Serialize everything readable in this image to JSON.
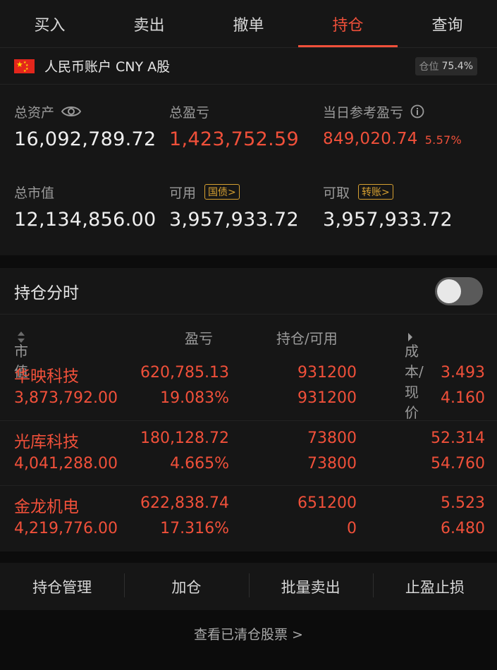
{
  "tabs": [
    {
      "label": "买入"
    },
    {
      "label": "卖出"
    },
    {
      "label": "撤单"
    },
    {
      "label": "持仓"
    },
    {
      "label": "查询"
    }
  ],
  "account": {
    "name": "人民币账户 CNY A股",
    "position_label": "仓位",
    "position_value": "75.4%",
    "total_assets_label": "总资产",
    "total_assets": "16,092,789.72",
    "total_pnl_label": "总盈亏",
    "total_pnl": "1,423,752.59",
    "daily_pnl_label": "当日参考盈亏",
    "daily_pnl": "849,020.74",
    "daily_pnl_pct": "5.57%",
    "market_value_label": "总市值",
    "market_value": "12,134,856.00",
    "available_label": "可用",
    "available_tag": "国债>",
    "available": "3,957,933.72",
    "withdrawable_label": "可取",
    "withdrawable_tag": "转账>",
    "withdrawable": "3,957,933.72"
  },
  "holdings": {
    "title": "持仓分时",
    "headers": {
      "market_value": "市值",
      "pnl": "盈亏",
      "qty": "持仓/可用",
      "price": "成本/现价"
    },
    "rows": [
      {
        "name": "华映科技",
        "market_value": "3,873,792.00",
        "pnl": "620,785.13",
        "pnl_pct": "19.083%",
        "position": "931200",
        "available": "931200",
        "cost": "3.493",
        "price": "4.160"
      },
      {
        "name": "光库科技",
        "market_value": "4,041,288.00",
        "pnl": "180,128.72",
        "pnl_pct": "4.665%",
        "position": "73800",
        "available": "73800",
        "cost": "52.314",
        "price": "54.760"
      },
      {
        "name": "金龙机电",
        "market_value": "4,219,776.00",
        "pnl": "622,838.74",
        "pnl_pct": "17.316%",
        "position": "651200",
        "available": "0",
        "cost": "5.523",
        "price": "6.480"
      }
    ]
  },
  "actions": [
    {
      "label": "持仓管理"
    },
    {
      "label": "加仓"
    },
    {
      "label": "批量卖出"
    },
    {
      "label": "止盈止损"
    }
  ],
  "footer": {
    "cleared_link": "查看已清仓股票 >"
  },
  "colors": {
    "accent_red": "#f0503a",
    "tag_gold": "#d6a031",
    "background": "#0c0c0c",
    "panel": "#161616"
  },
  "icons": [
    "eye-icon",
    "info-icon",
    "sort-icon",
    "chevron-right-icon",
    "china-flag-icon"
  ]
}
